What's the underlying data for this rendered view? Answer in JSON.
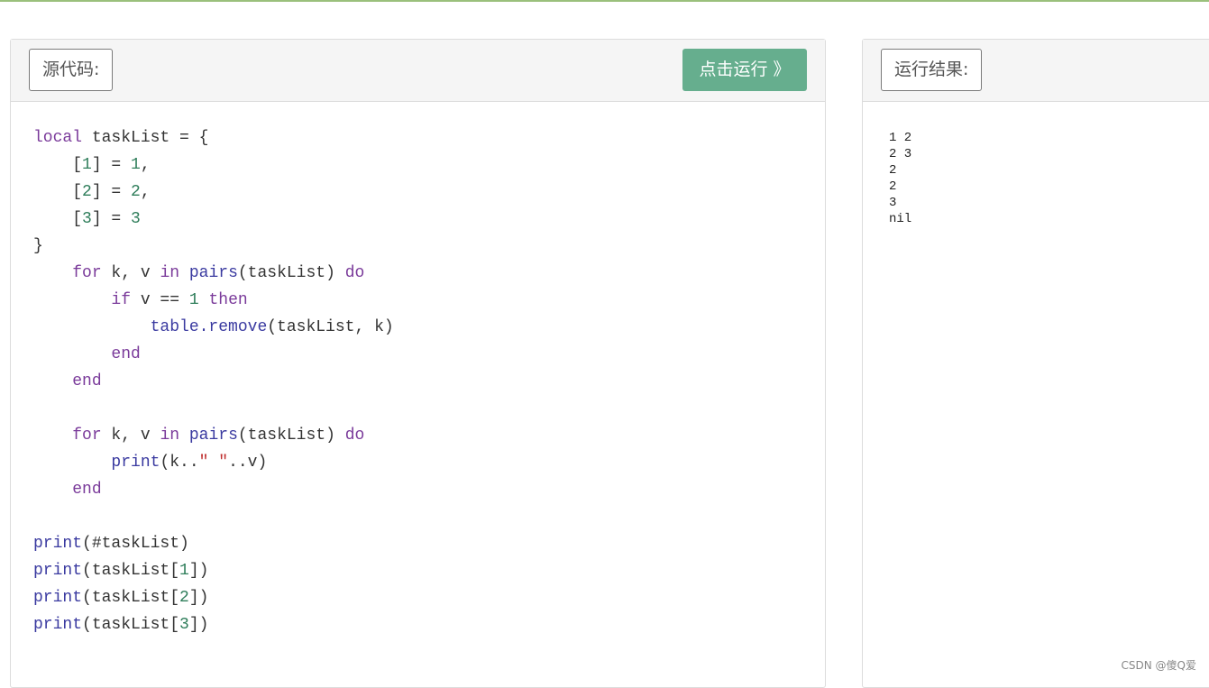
{
  "source_panel": {
    "header_label": "源代码:",
    "run_button_label": "点击运行 》",
    "code_lines": [
      [
        {
          "t": "kw",
          "v": "local"
        },
        {
          "t": "plain",
          "v": " taskList = {"
        }
      ],
      [
        {
          "t": "plain",
          "v": "    ["
        },
        {
          "t": "num",
          "v": "1"
        },
        {
          "t": "plain",
          "v": "] = "
        },
        {
          "t": "num",
          "v": "1"
        },
        {
          "t": "plain",
          "v": ","
        }
      ],
      [
        {
          "t": "plain",
          "v": "    ["
        },
        {
          "t": "num",
          "v": "2"
        },
        {
          "t": "plain",
          "v": "] = "
        },
        {
          "t": "num",
          "v": "2"
        },
        {
          "t": "plain",
          "v": ","
        }
      ],
      [
        {
          "t": "plain",
          "v": "    ["
        },
        {
          "t": "num",
          "v": "3"
        },
        {
          "t": "plain",
          "v": "] = "
        },
        {
          "t": "num",
          "v": "3"
        }
      ],
      [
        {
          "t": "plain",
          "v": "}"
        }
      ],
      [
        {
          "t": "plain",
          "v": "    "
        },
        {
          "t": "kw",
          "v": "for"
        },
        {
          "t": "plain",
          "v": " k, v "
        },
        {
          "t": "kw",
          "v": "in"
        },
        {
          "t": "plain",
          "v": " "
        },
        {
          "t": "fn",
          "v": "pairs"
        },
        {
          "t": "plain",
          "v": "(taskList) "
        },
        {
          "t": "kw",
          "v": "do"
        }
      ],
      [
        {
          "t": "plain",
          "v": "        "
        },
        {
          "t": "kw",
          "v": "if"
        },
        {
          "t": "plain",
          "v": " v == "
        },
        {
          "t": "num",
          "v": "1"
        },
        {
          "t": "plain",
          "v": " "
        },
        {
          "t": "kw",
          "v": "then"
        }
      ],
      [
        {
          "t": "plain",
          "v": "            "
        },
        {
          "t": "fn",
          "v": "table.remove"
        },
        {
          "t": "plain",
          "v": "(taskList, k)"
        }
      ],
      [
        {
          "t": "plain",
          "v": "        "
        },
        {
          "t": "kw",
          "v": "end"
        }
      ],
      [
        {
          "t": "plain",
          "v": "    "
        },
        {
          "t": "kw",
          "v": "end"
        }
      ],
      [],
      [
        {
          "t": "plain",
          "v": "    "
        },
        {
          "t": "kw",
          "v": "for"
        },
        {
          "t": "plain",
          "v": " k, v "
        },
        {
          "t": "kw",
          "v": "in"
        },
        {
          "t": "plain",
          "v": " "
        },
        {
          "t": "fn",
          "v": "pairs"
        },
        {
          "t": "plain",
          "v": "(taskList) "
        },
        {
          "t": "kw",
          "v": "do"
        }
      ],
      [
        {
          "t": "plain",
          "v": "        "
        },
        {
          "t": "fn",
          "v": "print"
        },
        {
          "t": "plain",
          "v": "(k.."
        },
        {
          "t": "str",
          "v": "\" \""
        },
        {
          "t": "plain",
          "v": "..v)"
        }
      ],
      [
        {
          "t": "plain",
          "v": "    "
        },
        {
          "t": "kw",
          "v": "end"
        }
      ],
      [],
      [
        {
          "t": "fn",
          "v": "print"
        },
        {
          "t": "plain",
          "v": "(#taskList)"
        }
      ],
      [
        {
          "t": "fn",
          "v": "print"
        },
        {
          "t": "plain",
          "v": "(taskList["
        },
        {
          "t": "num",
          "v": "1"
        },
        {
          "t": "plain",
          "v": "])"
        }
      ],
      [
        {
          "t": "fn",
          "v": "print"
        },
        {
          "t": "plain",
          "v": "(taskList["
        },
        {
          "t": "num",
          "v": "2"
        },
        {
          "t": "plain",
          "v": "])"
        }
      ],
      [
        {
          "t": "fn",
          "v": "print"
        },
        {
          "t": "plain",
          "v": "(taskList["
        },
        {
          "t": "num",
          "v": "3"
        },
        {
          "t": "plain",
          "v": "])"
        }
      ]
    ]
  },
  "result_panel": {
    "header_label": "运行结果:",
    "output_lines": [
      "1 2",
      "2 3",
      "2",
      "2",
      "3",
      "nil"
    ]
  },
  "watermark": "CSDN @傻Q爱",
  "colors": {
    "accent_bar": "#9ac07c",
    "run_button": "#66ae8e",
    "keyword": "#7a3a9a",
    "number": "#2e7d5a",
    "function": "#3a3aa0",
    "string": "#c03030"
  }
}
